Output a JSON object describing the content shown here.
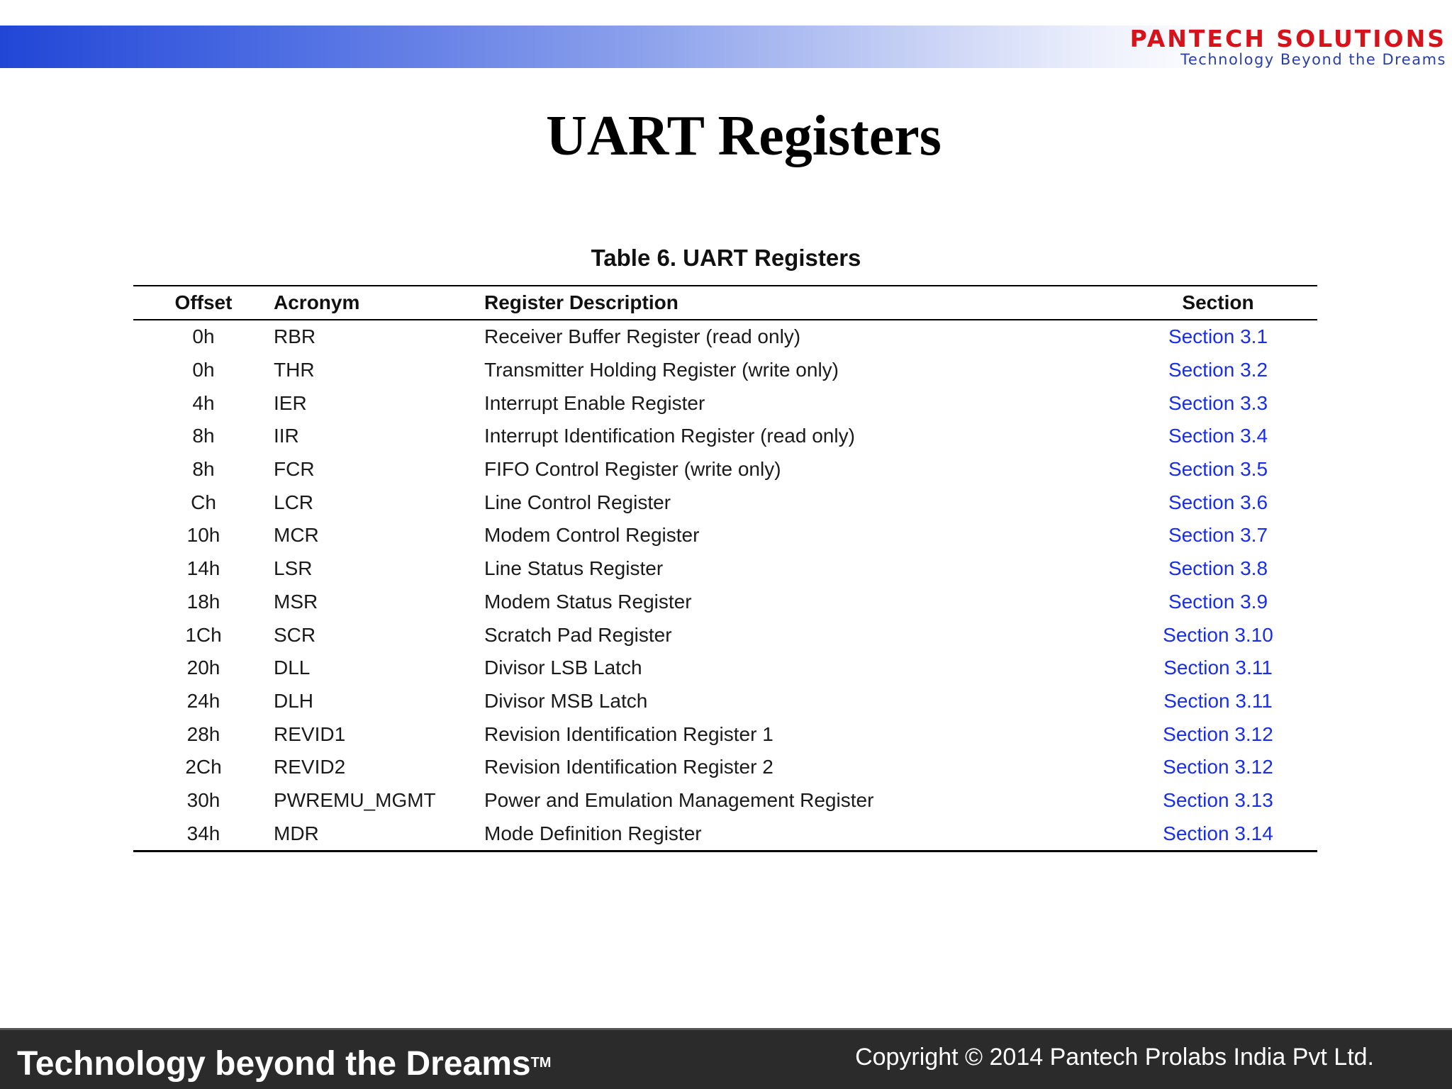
{
  "header": {
    "logo_text": "PANTECH SOLUTIONS",
    "logo_tagline": "Technology Beyond the Dreams",
    "colors": {
      "band_start": "#2146d6",
      "logo_red": "#d8121a",
      "logo_blue": "#2a3fa6"
    }
  },
  "slide": {
    "title": "UART Registers"
  },
  "table": {
    "caption": "Table 6. UART Registers",
    "headers": {
      "offset": "Offset",
      "acronym": "Acronym",
      "description": "Register Description",
      "section": "Section"
    },
    "link_color": "#1a2ee8",
    "rows": [
      {
        "offset": "0h",
        "acronym": "RBR",
        "description": "Receiver Buffer Register (read only)",
        "section": "Section 3.1"
      },
      {
        "offset": "0h",
        "acronym": "THR",
        "description": "Transmitter Holding Register (write only)",
        "section": "Section 3.2"
      },
      {
        "offset": "4h",
        "acronym": "IER",
        "description": "Interrupt Enable Register",
        "section": "Section 3.3"
      },
      {
        "offset": "8h",
        "acronym": "IIR",
        "description": "Interrupt Identification Register (read only)",
        "section": "Section 3.4"
      },
      {
        "offset": "8h",
        "acronym": "FCR",
        "description": "FIFO Control Register (write only)",
        "section": "Section 3.5"
      },
      {
        "offset": "Ch",
        "acronym": "LCR",
        "description": "Line Control Register",
        "section": "Section 3.6"
      },
      {
        "offset": "10h",
        "acronym": "MCR",
        "description": "Modem Control Register",
        "section": "Section 3.7"
      },
      {
        "offset": "14h",
        "acronym": "LSR",
        "description": "Line Status Register",
        "section": "Section 3.8"
      },
      {
        "offset": "18h",
        "acronym": "MSR",
        "description": "Modem Status Register",
        "section": "Section 3.9"
      },
      {
        "offset": "1Ch",
        "acronym": "SCR",
        "description": "Scratch Pad Register",
        "section": "Section 3.10"
      },
      {
        "offset": "20h",
        "acronym": "DLL",
        "description": "Divisor LSB Latch",
        "section": "Section 3.11"
      },
      {
        "offset": "24h",
        "acronym": "DLH",
        "description": "Divisor MSB Latch",
        "section": "Section 3.11"
      },
      {
        "offset": "28h",
        "acronym": "REVID1",
        "description": "Revision Identification Register 1",
        "section": "Section 3.12"
      },
      {
        "offset": "2Ch",
        "acronym": "REVID2",
        "description": "Revision Identification Register 2",
        "section": "Section 3.12"
      },
      {
        "offset": "30h",
        "acronym": "PWREMU_MGMT",
        "description": "Power and Emulation Management Register",
        "section": "Section 3.13"
      },
      {
        "offset": "34h",
        "acronym": "MDR",
        "description": "Mode Definition Register",
        "section": "Section 3.14"
      }
    ]
  },
  "footer": {
    "tagline": "Technology beyond the Dreams",
    "trademark": "TM",
    "copyright": "Copyright © 2014 Pantech Prolabs India Pvt Ltd.",
    "bar_color": "#2b2b2b"
  }
}
